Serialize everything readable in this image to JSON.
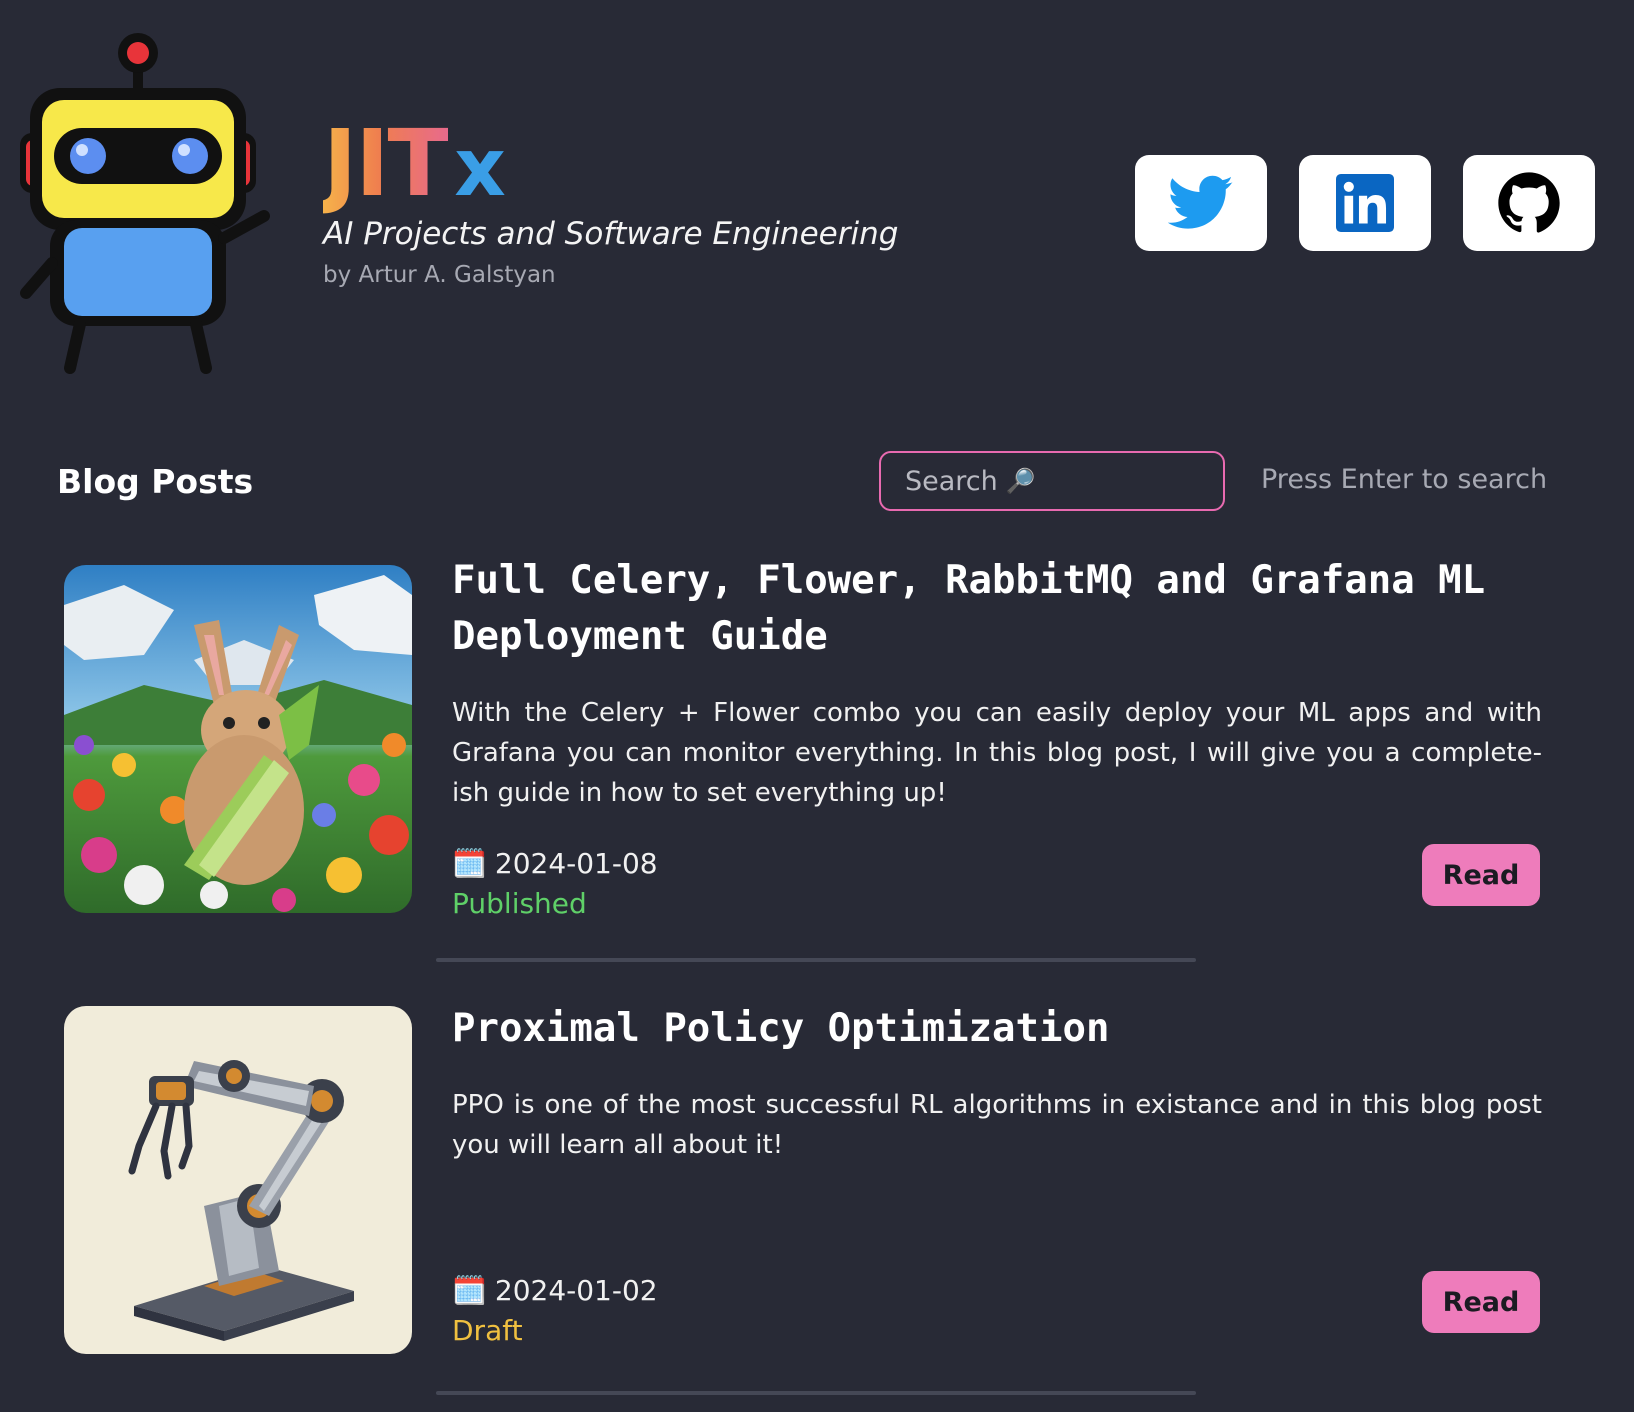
{
  "header": {
    "brand_jit": "JIT",
    "brand_x": "x",
    "tagline": "AI Projects and Software Engineering",
    "author": "by Artur A. Galstyan"
  },
  "socials": [
    {
      "name": "twitter",
      "icon": "twitter-icon",
      "color": "#1d9bf0"
    },
    {
      "name": "linkedin",
      "icon": "linkedin-icon",
      "color": "#0a66c2"
    },
    {
      "name": "github",
      "icon": "github-icon",
      "color": "#000000"
    }
  ],
  "blog": {
    "section_title": "Blog Posts",
    "search_placeholder": "Search",
    "search_icon": "magnifier-icon",
    "search_hint": "Press Enter to search"
  },
  "posts": [
    {
      "title": "Full Celery, Flower, RabbitMQ and Grafana ML Deployment Guide",
      "excerpt": "With the Celery + Flower combo you can easily deploy your ML apps and with Grafana you can monitor everything. In this blog post, I will give you a complete-ish guide in how to set everything up!",
      "date": "2024-01-08",
      "status": "Published",
      "status_color": "#5fd068",
      "read_label": "Read",
      "thumbnail": "rabbit-eating-celery-in-flower-field"
    },
    {
      "title": "Proximal Policy Optimization",
      "excerpt": "PPO is one of the most successful RL algorithms in existance and in this blog post you will learn all about it!",
      "date": "2024-01-02",
      "status": "Draft",
      "status_color": "#f0c040",
      "read_label": "Read",
      "thumbnail": "low-poly-robot-arm"
    }
  ],
  "colors": {
    "background": "#282a36",
    "accent_pink": "#ee7cbb",
    "brand_blue": "#3a9ee6"
  }
}
